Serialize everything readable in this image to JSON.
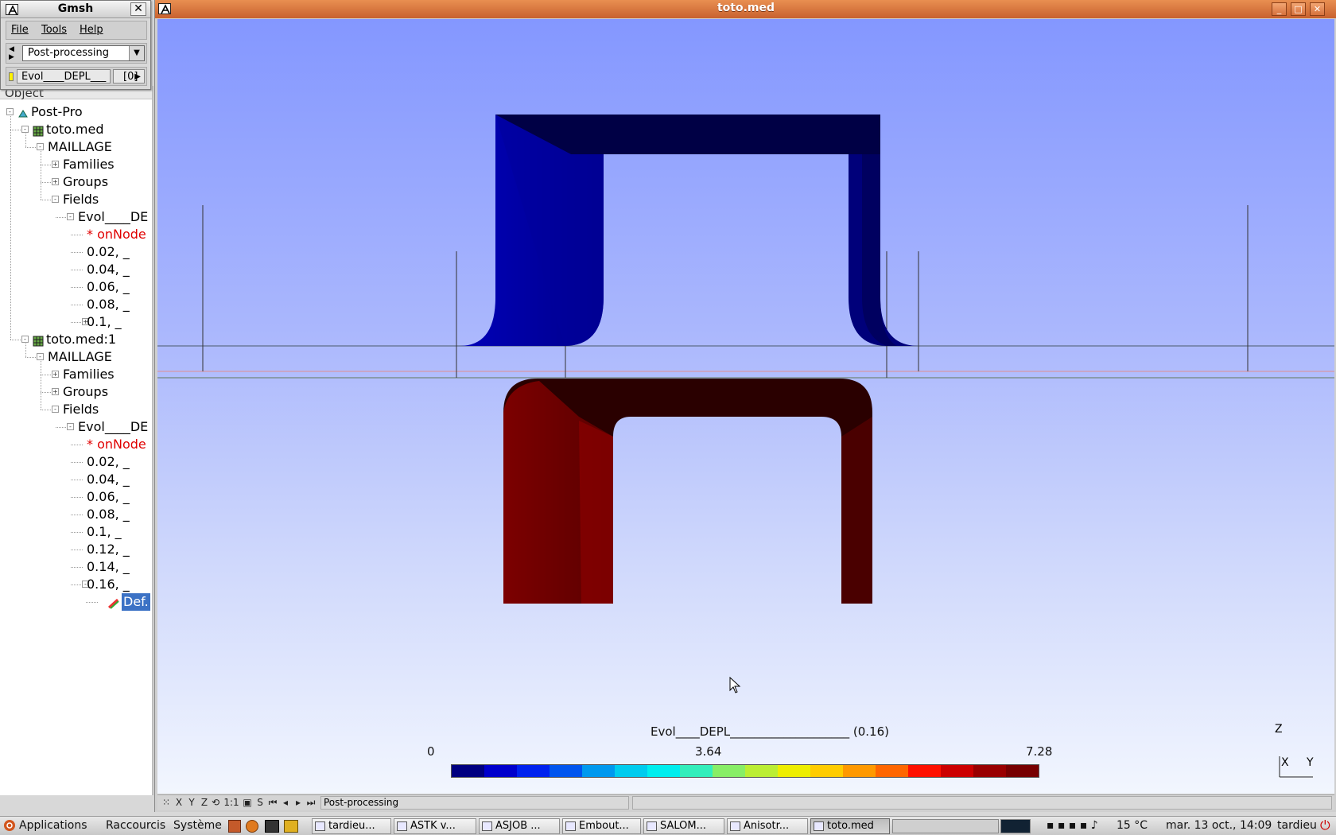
{
  "gmsh": {
    "title": "Gmsh",
    "close": "✕",
    "menu": {
      "file": "File",
      "tools": "Tools",
      "help": "Help"
    },
    "module": "Post-processing",
    "view_name": "Evol____DEPL___",
    "view_index": "[0]"
  },
  "tree": {
    "header": "Object",
    "nodes": [
      {
        "label": "Post-Pro"
      },
      {
        "label": "toto.med"
      },
      {
        "label": "MAILLAGE"
      },
      {
        "label": "Families"
      },
      {
        "label": "Groups"
      },
      {
        "label": "Fields"
      },
      {
        "label": "Evol____DE"
      },
      {
        "label": "* onNode"
      },
      {
        "label": "0.02, _"
      },
      {
        "label": "0.04, _"
      },
      {
        "label": "0.06, _"
      },
      {
        "label": "0.08, _"
      },
      {
        "label": "0.1, _"
      },
      {
        "label": "toto.med:1"
      },
      {
        "label": "MAILLAGE"
      },
      {
        "label": "Families"
      },
      {
        "label": "Groups"
      },
      {
        "label": "Fields"
      },
      {
        "label": "Evol____DE"
      },
      {
        "label": "* onNode"
      },
      {
        "label": "0.02, _"
      },
      {
        "label": "0.04, _"
      },
      {
        "label": "0.06, _"
      },
      {
        "label": "0.08, _"
      },
      {
        "label": "0.1, _"
      },
      {
        "label": "0.12, _"
      },
      {
        "label": "0.14, _"
      },
      {
        "label": "0.16, _"
      },
      {
        "label": "Def."
      }
    ]
  },
  "main": {
    "title": "toto.med",
    "scale": {
      "title": "Evol____DEPL____________________ (0.16)",
      "min": "0",
      "mid": "3.64",
      "max": "7.28",
      "colors": [
        "#000080",
        "#0000cc",
        "#0022ee",
        "#0055ee",
        "#0099ee",
        "#00ccee",
        "#00eeee",
        "#33eebb",
        "#88ee66",
        "#bbee33",
        "#eeee00",
        "#ffcc00",
        "#ff9900",
        "#ff6600",
        "#ff1100",
        "#cc0000",
        "#990000",
        "#770000"
      ]
    },
    "axes": {
      "z": "Z",
      "x": "X",
      "y": "Y"
    },
    "status": {
      "toolbar": [
        "X",
        "Y",
        "Z",
        "1:1",
        "S"
      ],
      "message": "Post-processing"
    }
  },
  "taskbar": {
    "menus": {
      "applications": "Applications",
      "places": "Raccourcis",
      "system": "Système"
    },
    "tasks": [
      "tardieu...",
      "ASTK v...",
      "ASJOB ...",
      "Embout...",
      "SALOM...",
      "Anisotr...",
      "toto.med"
    ],
    "weather": "15 °C",
    "clock": "mar. 13 oct., 14:09",
    "user": "tardieu"
  }
}
